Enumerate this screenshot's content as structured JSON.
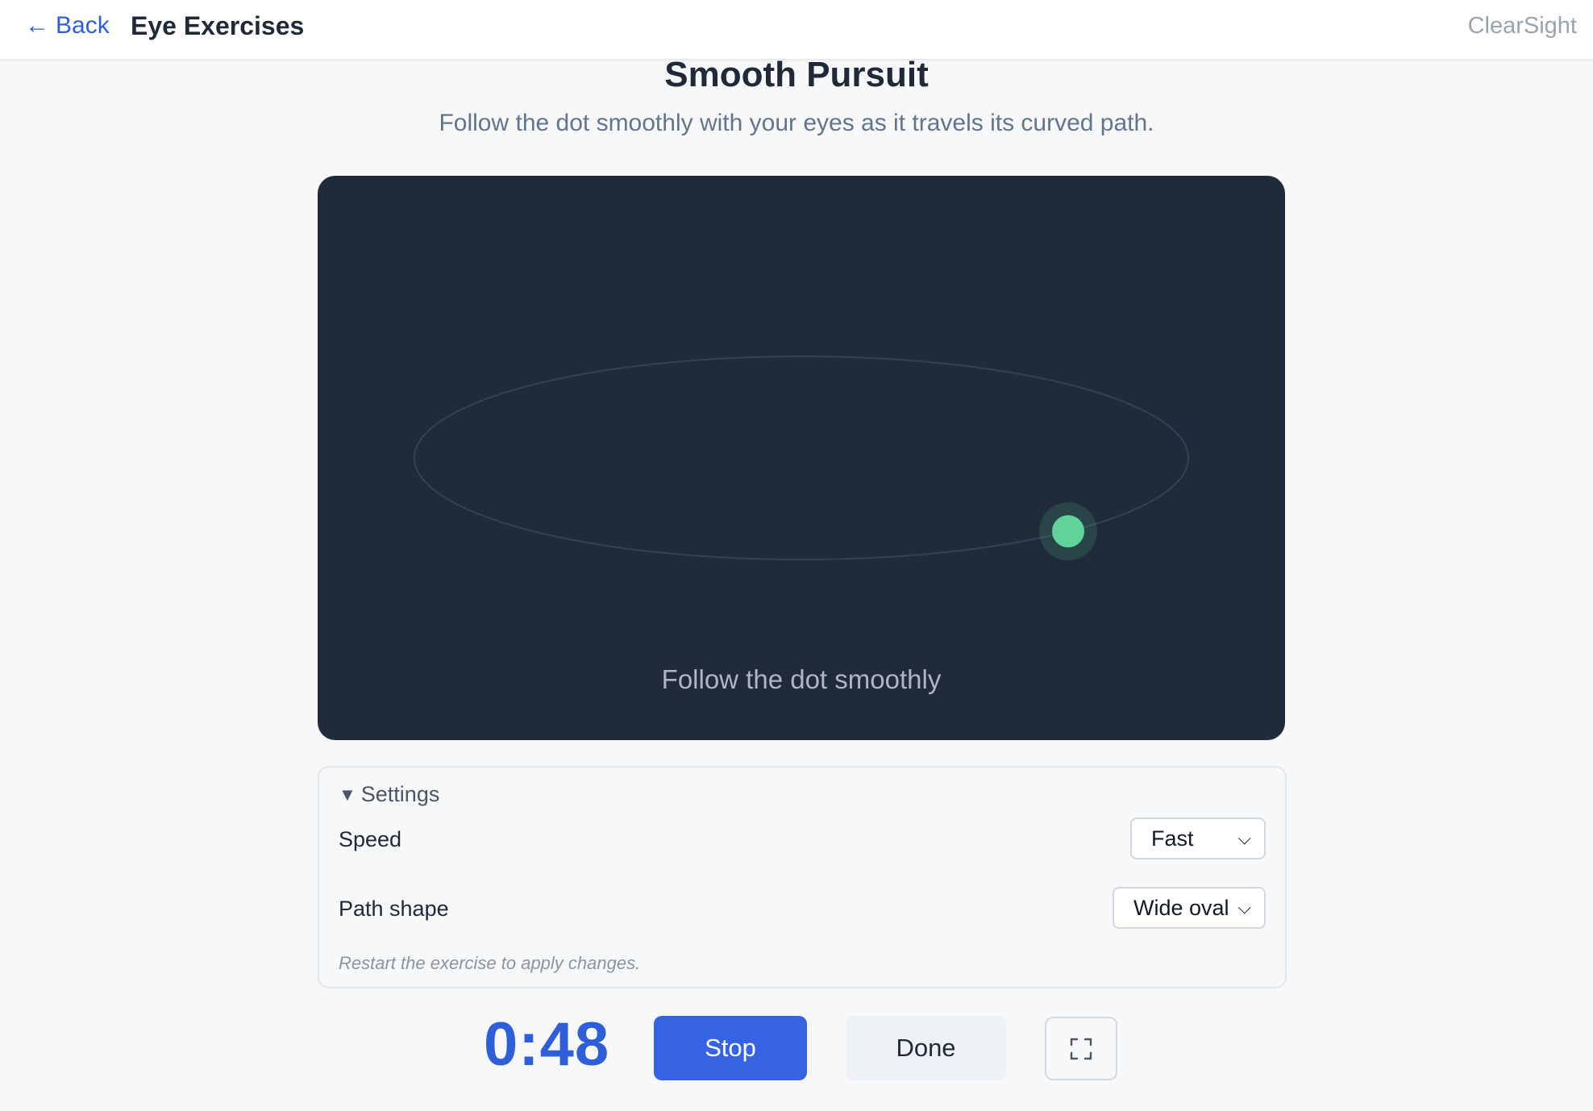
{
  "nav": {
    "back_label": "Back",
    "back_icon": "←",
    "title": "Eye Exercises",
    "brand": "ClearSight"
  },
  "exercise": {
    "title": "Smooth Pursuit",
    "subtitle": "Follow the dot smoothly with your eyes as it travels its curved path.",
    "stage_caption": "Follow the dot smoothly"
  },
  "settings": {
    "summary_label": "Settings",
    "speed_label": "Speed",
    "speed_value": "Fast",
    "speed_options": [
      "Fast"
    ],
    "path_label": "Path shape",
    "path_value": "Wide oval",
    "path_options": [
      "Wide oval"
    ],
    "note": "Restart the exercise to apply changes."
  },
  "controls": {
    "timer": "0:48",
    "stop_label": "Stop",
    "done_label": "Done",
    "fullscreen_icon": "fullscreen-icon"
  },
  "colors": {
    "accent": "#3563e3",
    "stage_background": "#212a3b",
    "dot": "#5fd39a"
  }
}
